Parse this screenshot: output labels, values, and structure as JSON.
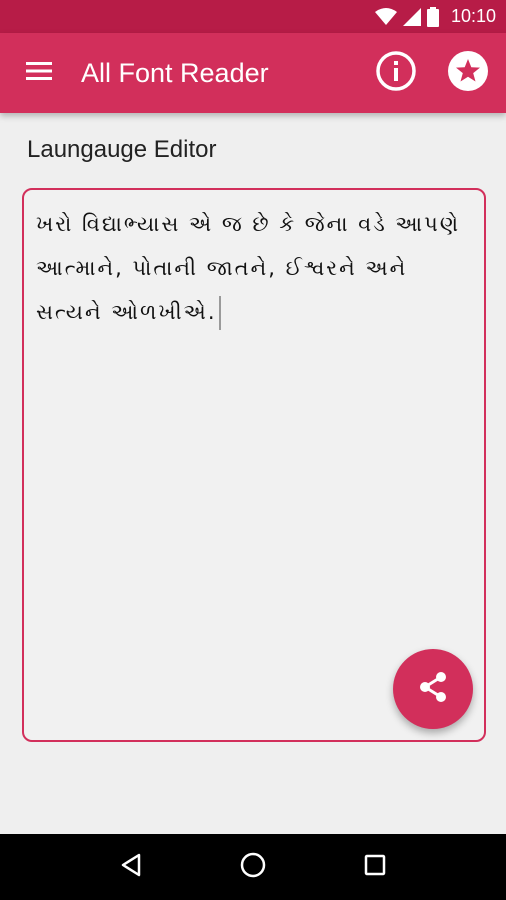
{
  "status_bar": {
    "time": "10:10",
    "icons": [
      "wifi-icon",
      "signal-icon",
      "battery-icon"
    ]
  },
  "app_bar": {
    "title": "All Font Reader",
    "icons": [
      "menu-icon",
      "info-icon",
      "star-icon"
    ]
  },
  "editor": {
    "label": "Laungauge Editor",
    "content": "ખરો વિદ્યાભ્યાસ એ જ છે કે જેના વડે આપણે આત્માને, પોતાની જાતને, ઈશ્વરને અને સત્યને ઓળખીએ."
  },
  "fab": {
    "icon": "share-icon"
  },
  "nav_bar": {
    "icons": [
      "back-icon",
      "home-icon",
      "recents-icon"
    ]
  },
  "colors": {
    "primary": "#d22f5b",
    "primary_dark": "#b71c47",
    "background": "#efefef"
  }
}
